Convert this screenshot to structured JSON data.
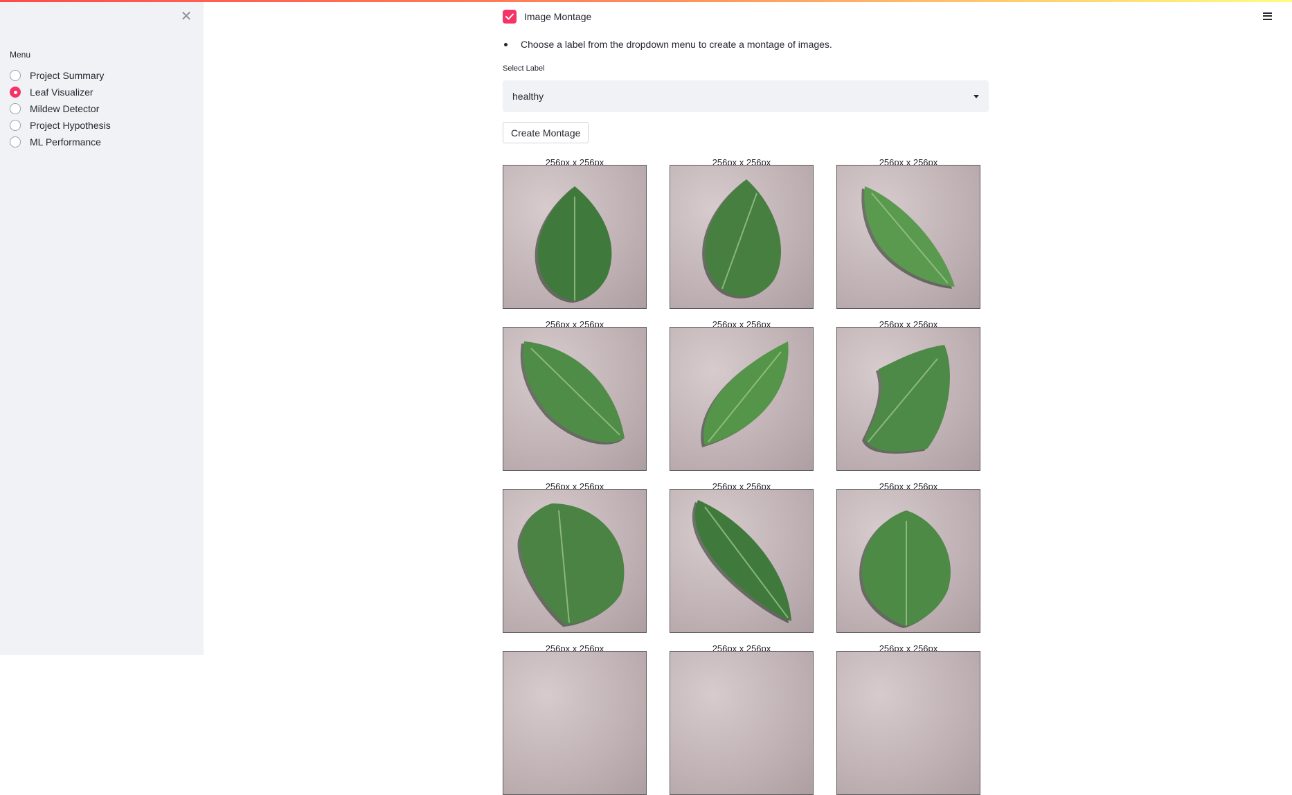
{
  "sidebar": {
    "menu_label": "Menu",
    "items": [
      {
        "label": "Project Summary",
        "selected": false
      },
      {
        "label": "Leaf Visualizer",
        "selected": true
      },
      {
        "label": "Mildew Detector",
        "selected": false
      },
      {
        "label": "Project Hypothesis",
        "selected": false
      },
      {
        "label": "ML Performance",
        "selected": false
      }
    ]
  },
  "main": {
    "checkbox_label": "Image Montage",
    "checkbox_checked": true,
    "instruction": "Choose a label from the dropdown menu to create a montage of images.",
    "select_label": "Select Label",
    "select_value": "healthy",
    "create_button": "Create Montage",
    "montage": {
      "titles": [
        [
          "256px x 256px",
          "256px x 256px",
          "256px x 256px"
        ],
        [
          "256px x 256px",
          "256px x 256px",
          "256px x 256px"
        ],
        [
          "256px x 256px",
          "256px x 256px",
          "256px x 256px"
        ],
        [
          "256px x 256px",
          "256px x 256px",
          "256px x 256px"
        ]
      ]
    }
  },
  "colors": {
    "accent": "#f63366",
    "sidebar_bg": "#f0f2f6",
    "leaf_green": "#4a8a45",
    "background_gray": "#c4b7ba"
  },
  "icons": {
    "close": "close-icon",
    "menu": "hamburger-menu-icon",
    "check": "check-icon",
    "dropdown": "chevron-down-icon"
  }
}
